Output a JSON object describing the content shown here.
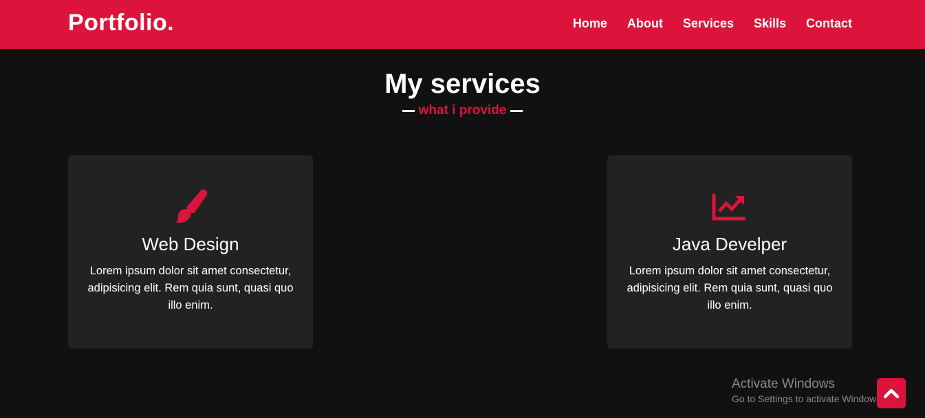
{
  "navbar": {
    "logo": "Portfolio.",
    "menu": [
      "Home",
      "About",
      "Services",
      "Skills",
      "Contact"
    ]
  },
  "services": {
    "title": "My services",
    "subtitle": "what i provide",
    "cards": [
      {
        "icon": "paint-brush-icon",
        "title": "Web Design",
        "description": "Lorem ipsum dolor sit amet consectetur, adipisicing elit. Rem quia sunt, quasi quo illo enim."
      },
      {
        "icon": "chart-line-icon",
        "title": "Java Develper",
        "description": "Lorem ipsum dolor sit amet consectetur, adipisicing elit. Rem quia sunt, quasi quo illo enim."
      }
    ]
  },
  "watermark": {
    "line1": "Activate Windows",
    "line2": "Go to Settings to activate Windows."
  },
  "scroll_top": {
    "icon": "chevron-up-icon"
  },
  "colors": {
    "accent": "#dc143c",
    "background": "#111111",
    "card": "#222222"
  }
}
